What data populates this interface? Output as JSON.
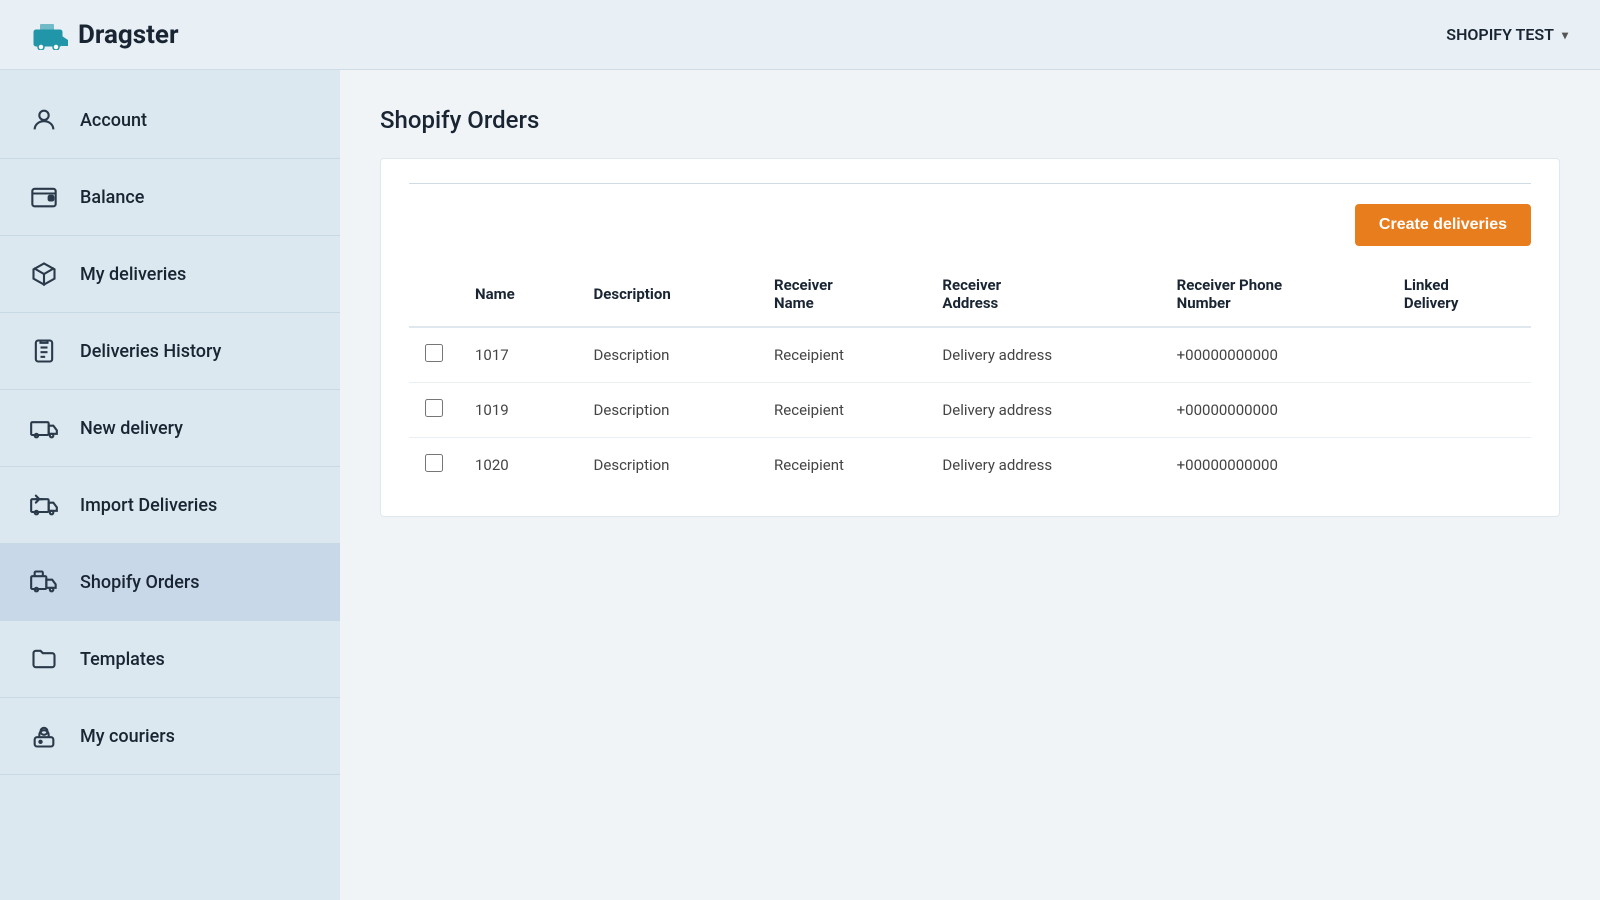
{
  "header": {
    "logo_text": "Dragster",
    "account_label": "SHOPIFY TEST",
    "chevron": "▾"
  },
  "sidebar": {
    "items": [
      {
        "id": "account",
        "label": "Account",
        "icon": "user"
      },
      {
        "id": "balance",
        "label": "Balance",
        "icon": "wallet"
      },
      {
        "id": "my-deliveries",
        "label": "My deliveries",
        "icon": "box"
      },
      {
        "id": "deliveries-history",
        "label": "Deliveries History",
        "icon": "clipboard"
      },
      {
        "id": "new-delivery",
        "label": "New delivery",
        "icon": "truck"
      },
      {
        "id": "import-deliveries",
        "label": "Import Deliveries",
        "icon": "truck-import"
      },
      {
        "id": "shopify-orders",
        "label": "Shopify Orders",
        "icon": "shopify-truck",
        "active": true
      },
      {
        "id": "templates",
        "label": "Templates",
        "icon": "folder"
      },
      {
        "id": "my-couriers",
        "label": "My couriers",
        "icon": "courier"
      }
    ]
  },
  "main": {
    "page_title": "Shopify Orders",
    "create_btn_label": "Create deliveries",
    "table": {
      "columns": [
        "Name",
        "Description",
        "Receiver Name",
        "Receiver Address",
        "Receiver Phone Number",
        "Linked Delivery"
      ],
      "rows": [
        {
          "name": "1017",
          "description": "Description",
          "receiver_name": "Receipient",
          "receiver_address": "Delivery address",
          "phone": "+00000000000",
          "linked": ""
        },
        {
          "name": "1019",
          "description": "Description",
          "receiver_name": "Receipient",
          "receiver_address": "Delivery address",
          "phone": "+00000000000",
          "linked": ""
        },
        {
          "name": "1020",
          "description": "Description",
          "receiver_name": "Receipient",
          "receiver_address": "Delivery address",
          "phone": "+00000000000",
          "linked": ""
        }
      ]
    }
  }
}
